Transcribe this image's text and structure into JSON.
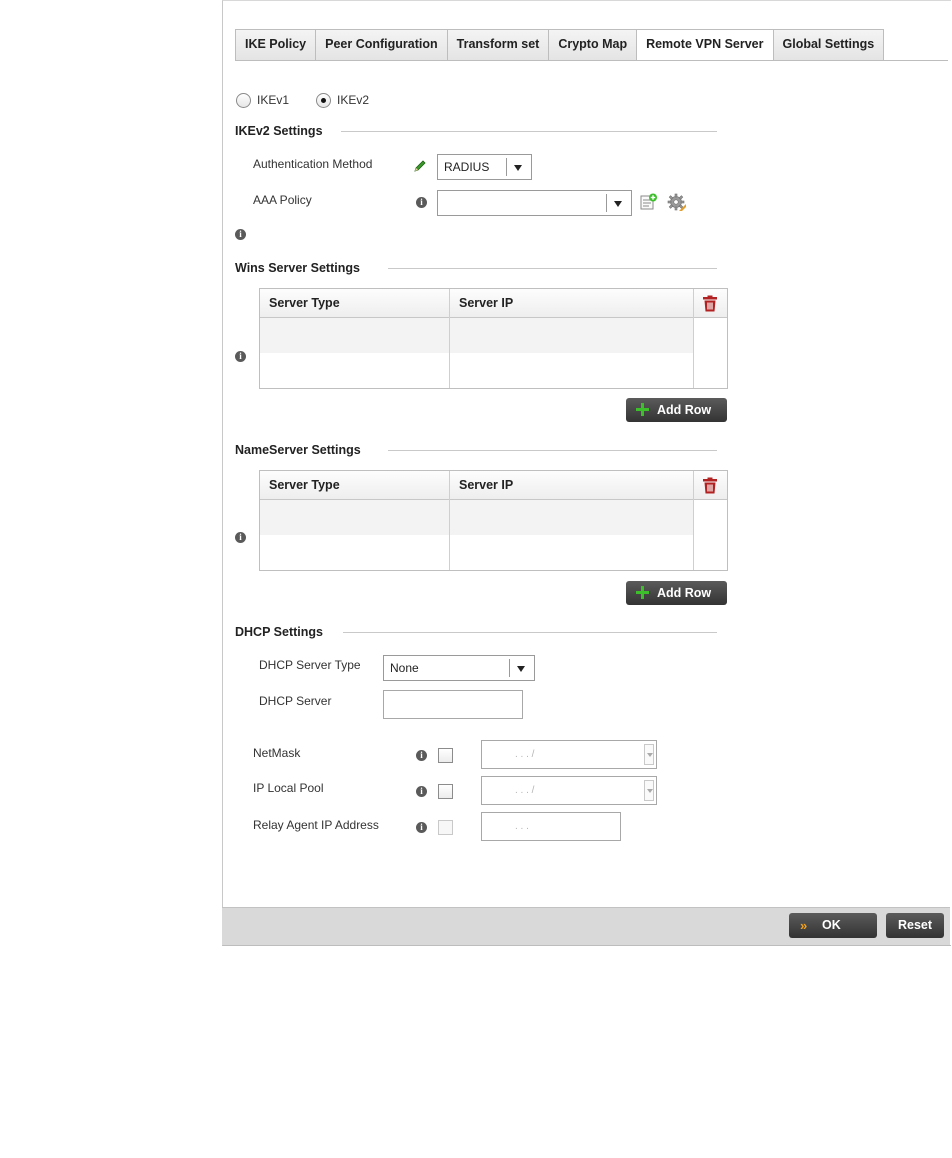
{
  "tabs": [
    "IKE Policy",
    "Peer Configuration",
    "Transform set",
    "Crypto Map",
    "Remote VPN Server",
    "Global Settings"
  ],
  "active_tab": "Remote VPN Server",
  "ike_version": {
    "options": [
      "IKEv1",
      "IKEv2"
    ],
    "selected": "IKEv2"
  },
  "ikev2": {
    "title": "IKEv2 Settings",
    "auth_method_label": "Authentication Method",
    "auth_method_value": "RADIUS",
    "aaa_policy_label": "AAA Policy",
    "aaa_policy_value": ""
  },
  "wins": {
    "title": "Wins Server Settings",
    "columns": [
      "Server Type",
      "Server IP"
    ],
    "rows": [],
    "add_row_label": "Add Row"
  },
  "nameserver": {
    "title": "NameServer Settings",
    "columns": [
      "Server Type",
      "Server IP"
    ],
    "rows": [],
    "add_row_label": "Add Row"
  },
  "dhcp": {
    "title": "DHCP Settings",
    "server_type_label": "DHCP Server Type",
    "server_type_value": "None",
    "server_label": "DHCP Server",
    "server_value": "",
    "netmask_label": "NetMask",
    "ip_local_pool_label": "IP Local Pool",
    "relay_agent_label": "Relay Agent IP Address",
    "ip_placeholder_mask": ".    .    .    /",
    "ip_placeholder": ".    .    ."
  },
  "footer": {
    "ok_label": "OK",
    "reset_label": "Reset"
  },
  "colors": {
    "add_plus": "#3cbf2a",
    "delete_icon": "#b32222",
    "ok_chevron": "#f0a020",
    "edit_pencil": "#3a9a2a"
  },
  "icons": [
    "info-icon",
    "edit-pencil-icon",
    "create-new-icon",
    "configure-gear-icon",
    "trash-icon",
    "plus-icon",
    "double-chevron-icon"
  ]
}
